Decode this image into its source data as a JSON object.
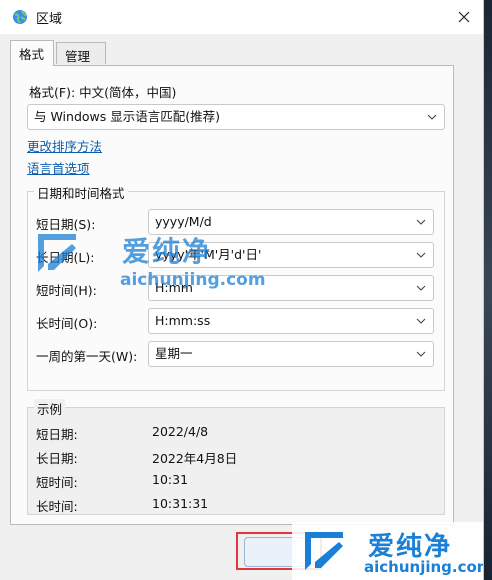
{
  "window": {
    "title": "区域",
    "icons": {
      "app": "globe-icon",
      "close": "close-icon"
    }
  },
  "tabs": [
    {
      "label": "格式",
      "active": true
    },
    {
      "label": "管理",
      "active": false
    }
  ],
  "format": {
    "label": "格式(F): 中文(简体，中国)",
    "selected": "与 Windows 显示语言匹配(推荐)"
  },
  "links": {
    "sort": "更改排序方法",
    "language_pref": "语言首选项"
  },
  "datetime_group": {
    "title": "日期和时间格式",
    "rows": [
      {
        "label": "短日期(S):",
        "value": "yyyy/M/d"
      },
      {
        "label": "长日期(L):",
        "value": "yyyy'年'M'月'd'日'"
      },
      {
        "label": "短时间(H):",
        "value": "H:mm"
      },
      {
        "label": "长时间(O):",
        "value": "H:mm:ss"
      },
      {
        "label": "一周的第一天(W):",
        "value": "星期一"
      }
    ]
  },
  "example_group": {
    "title": "示例",
    "rows": [
      {
        "label": "短日期:",
        "value": "2022/4/8"
      },
      {
        "label": "长日期:",
        "value": "2022年4月8日"
      },
      {
        "label": "短时间:",
        "value": "10:31"
      },
      {
        "label": "长时间:",
        "value": "10:31:31"
      }
    ]
  },
  "watermark": {
    "brand": "爱纯净",
    "url": "aichunjing.com",
    "color": "#1a7fd6"
  },
  "colors": {
    "link": "#0b5cad",
    "highlight": "#e0383e"
  }
}
